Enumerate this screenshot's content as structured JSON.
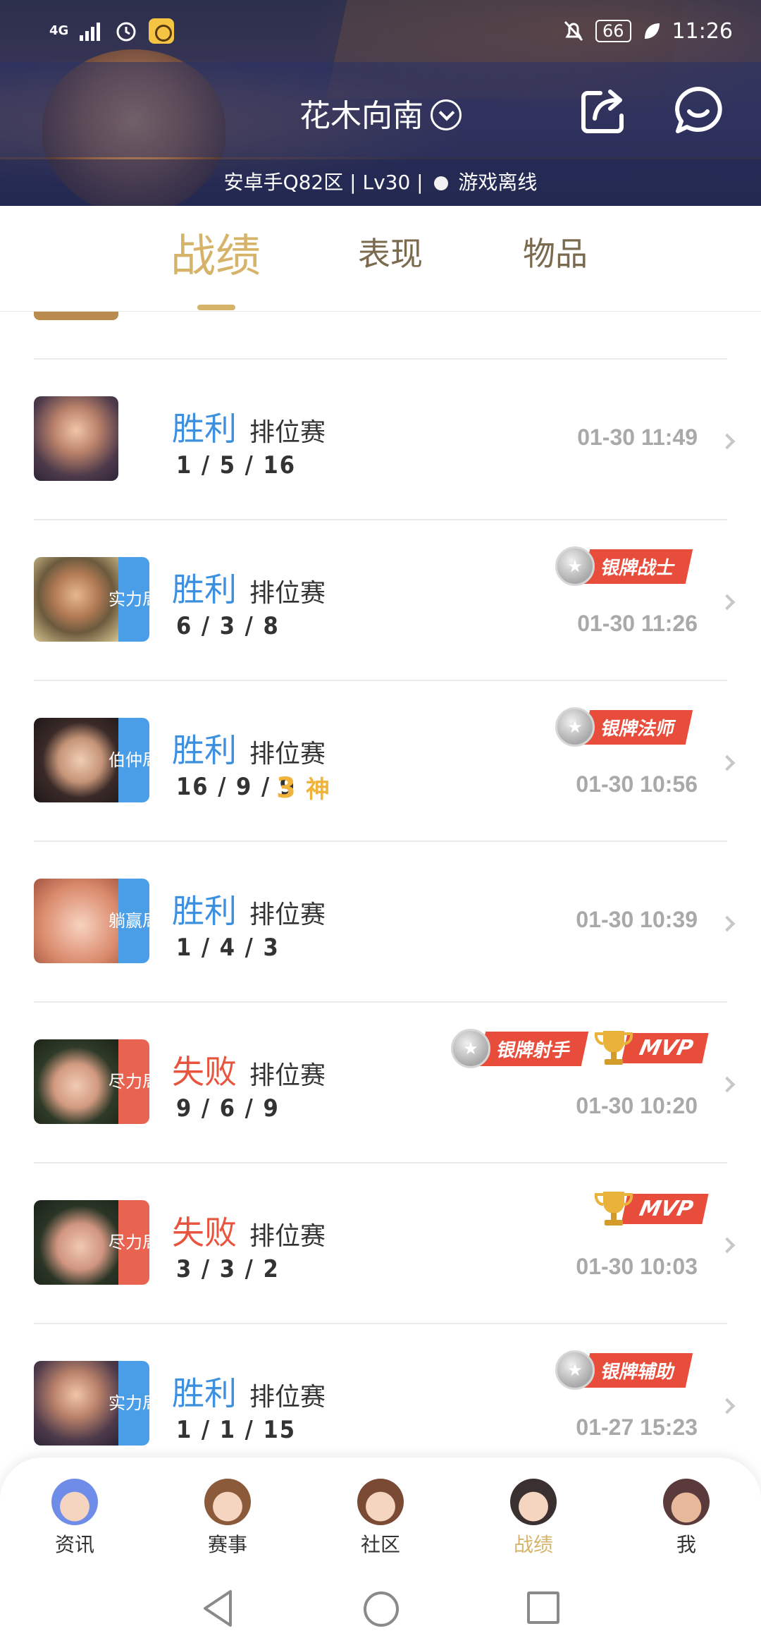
{
  "status_bar": {
    "network": "4G",
    "battery": "66",
    "time": "11:26"
  },
  "header": {
    "user_name": "花木向南",
    "server_info": "安卓手Q82区 | Lv30 |",
    "online_status": "游戏离线"
  },
  "tabs": [
    {
      "label": "战绩",
      "active": true
    },
    {
      "label": "表现",
      "active": false
    },
    {
      "label": "物品",
      "active": false
    }
  ],
  "matches": [
    {
      "result": "胜利",
      "result_type": "win",
      "mode": "排位赛",
      "kda": "1 / 5 / 16",
      "time": "01-30 11:49",
      "tag": "",
      "badges": []
    },
    {
      "result": "胜利",
      "result_type": "win",
      "mode": "排位赛",
      "kda": "6 / 3 / 8",
      "time": "01-30 11:26",
      "tag": "实力局",
      "tag_color": "blue",
      "badges": [
        {
          "type": "silver",
          "label": "银牌战士"
        }
      ]
    },
    {
      "result": "胜利",
      "result_type": "win",
      "mode": "排位赛",
      "kda": "16 / 9 / 9",
      "time": "01-30 10:56",
      "tag": "伯仲局",
      "tag_color": "blue",
      "streak_num": "3",
      "streak_label": "神",
      "badges": [
        {
          "type": "silver",
          "label": "银牌法师"
        }
      ]
    },
    {
      "result": "胜利",
      "result_type": "win",
      "mode": "排位赛",
      "kda": "1 / 4 / 3",
      "time": "01-30 10:39",
      "tag": "躺赢局",
      "tag_color": "blue",
      "badges": []
    },
    {
      "result": "失败",
      "result_type": "lose",
      "mode": "排位赛",
      "kda": "9 / 6 / 9",
      "time": "01-30 10:20",
      "tag": "尽力局",
      "tag_color": "red",
      "badges": [
        {
          "type": "silver",
          "label": "银牌射手"
        },
        {
          "type": "mvp",
          "label": "MVP"
        }
      ]
    },
    {
      "result": "失败",
      "result_type": "lose",
      "mode": "排位赛",
      "kda": "3 / 3 / 2",
      "time": "01-30 10:03",
      "tag": "尽力局",
      "tag_color": "red",
      "badges": [
        {
          "type": "mvp",
          "label": "MVP"
        }
      ]
    },
    {
      "result": "胜利",
      "result_type": "win",
      "mode": "排位赛",
      "kda": "1 / 1 / 15",
      "time": "01-27 15:23",
      "tag": "实力局",
      "tag_color": "blue",
      "badges": [
        {
          "type": "silver",
          "label": "银牌辅助"
        }
      ]
    }
  ],
  "bottom_nav": [
    {
      "label": "资讯",
      "active": false
    },
    {
      "label": "赛事",
      "active": false
    },
    {
      "label": "社区",
      "active": false
    },
    {
      "label": "战绩",
      "active": true
    },
    {
      "label": "我",
      "active": false
    }
  ],
  "colors": {
    "accent_gold": "#d5b46a",
    "win_blue": "#3d8fe0",
    "lose_red": "#e8543e",
    "badge_red": "#e84d3c"
  }
}
